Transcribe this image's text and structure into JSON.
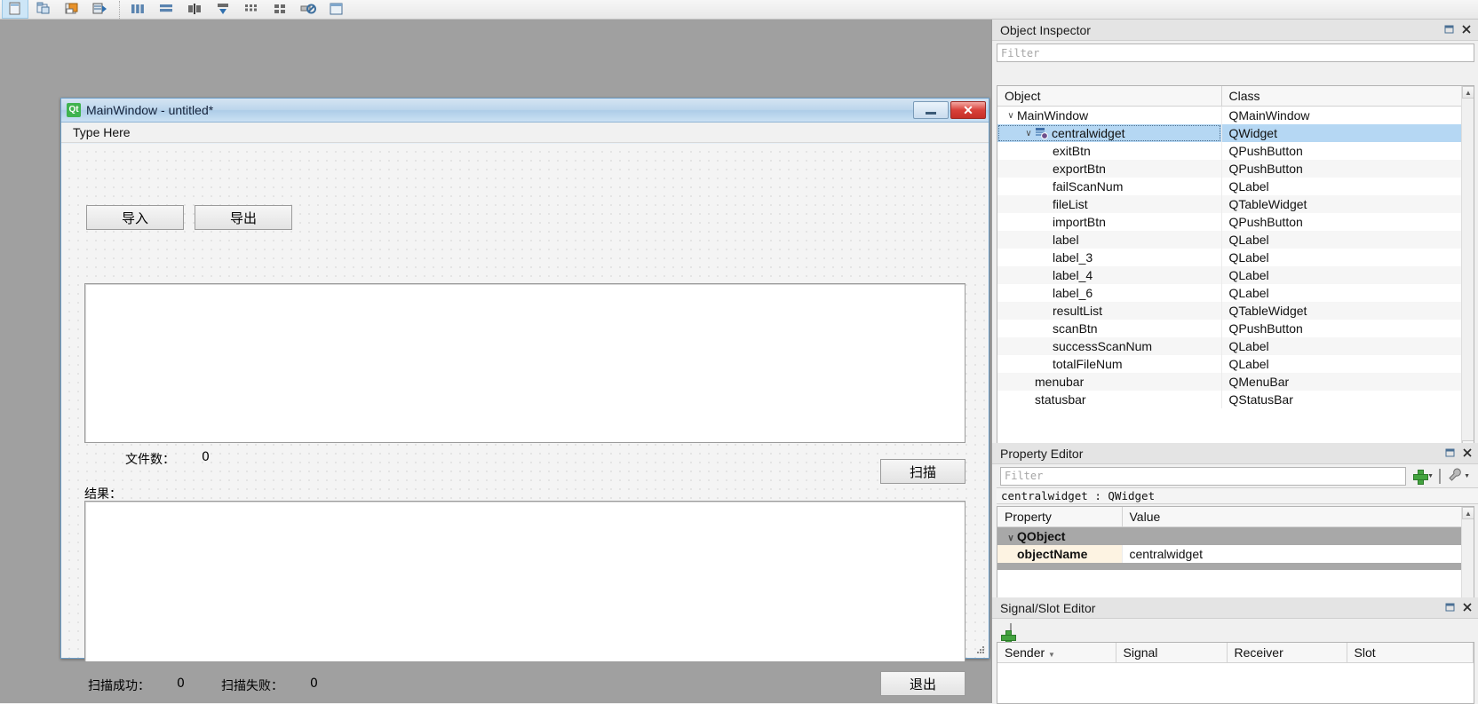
{
  "toolbar": {
    "icons": [
      {
        "name": "new-form-icon",
        "glyph": "▣",
        "selected": true
      },
      {
        "name": "open-form-icon",
        "glyph": "▤",
        "selected": false
      },
      {
        "name": "save-form-icon",
        "glyph": "◆",
        "selected": false
      },
      {
        "name": "print-preview-icon",
        "glyph": "▥",
        "selected": false
      },
      {
        "name": "separator",
        "glyph": "",
        "selected": false
      },
      {
        "name": "layout-horizontally-icon",
        "glyph": "‖",
        "selected": false
      },
      {
        "name": "layout-vertically-icon",
        "glyph": "≡",
        "selected": false
      },
      {
        "name": "layout-splitter-horizontal-icon",
        "glyph": "▦",
        "selected": false
      },
      {
        "name": "layout-splitter-vertical-icon",
        "glyph": "⊥",
        "selected": false
      },
      {
        "name": "layout-grid-icon",
        "glyph": "⌸",
        "selected": false
      },
      {
        "name": "layout-form-icon",
        "glyph": "⊞",
        "selected": false
      },
      {
        "name": "break-layout-icon",
        "glyph": "⛔",
        "selected": false
      },
      {
        "name": "adjust-size-icon",
        "glyph": "□",
        "selected": false
      }
    ]
  },
  "form": {
    "title": "MainWindow - untitled*",
    "logo_text": "Qt",
    "minimize_label": "",
    "close_label": "✕",
    "menubar_placeholder": "Type Here",
    "widgets": {
      "import_button": "导入",
      "export_button": "导出",
      "file_count_label": "文件数：",
      "file_count_value": "0",
      "scan_button": "扫描",
      "result_label": "结果：",
      "scan_success_label": "扫描成功：",
      "scan_success_value": "0",
      "scan_fail_label": "扫描失败：",
      "scan_fail_value": "0",
      "exit_button": "退出"
    }
  },
  "object_inspector": {
    "title": "Object Inspector",
    "filter_placeholder": "Filter",
    "columns": [
      "Object",
      "Class"
    ],
    "rows": [
      {
        "indent": 0,
        "chevron": "∨",
        "icon": "",
        "object": "MainWindow",
        "class": "QMainWindow",
        "selected": false
      },
      {
        "indent": 1,
        "chevron": "∨",
        "icon": "widget-icon",
        "object": "centralwidget",
        "class": "QWidget",
        "selected": true
      },
      {
        "indent": 2,
        "chevron": "",
        "icon": "",
        "object": "exitBtn",
        "class": "QPushButton",
        "selected": false
      },
      {
        "indent": 2,
        "chevron": "",
        "icon": "",
        "object": "exportBtn",
        "class": "QPushButton",
        "selected": false
      },
      {
        "indent": 2,
        "chevron": "",
        "icon": "",
        "object": "failScanNum",
        "class": "QLabel",
        "selected": false
      },
      {
        "indent": 2,
        "chevron": "",
        "icon": "",
        "object": "fileList",
        "class": "QTableWidget",
        "selected": false
      },
      {
        "indent": 2,
        "chevron": "",
        "icon": "",
        "object": "importBtn",
        "class": "QPushButton",
        "selected": false
      },
      {
        "indent": 2,
        "chevron": "",
        "icon": "",
        "object": "label",
        "class": "QLabel",
        "selected": false
      },
      {
        "indent": 2,
        "chevron": "",
        "icon": "",
        "object": "label_3",
        "class": "QLabel",
        "selected": false
      },
      {
        "indent": 2,
        "chevron": "",
        "icon": "",
        "object": "label_4",
        "class": "QLabel",
        "selected": false
      },
      {
        "indent": 2,
        "chevron": "",
        "icon": "",
        "object": "label_6",
        "class": "QLabel",
        "selected": false
      },
      {
        "indent": 2,
        "chevron": "",
        "icon": "",
        "object": "resultList",
        "class": "QTableWidget",
        "selected": false
      },
      {
        "indent": 2,
        "chevron": "",
        "icon": "",
        "object": "scanBtn",
        "class": "QPushButton",
        "selected": false
      },
      {
        "indent": 2,
        "chevron": "",
        "icon": "",
        "object": "successScanNum",
        "class": "QLabel",
        "selected": false
      },
      {
        "indent": 2,
        "chevron": "",
        "icon": "",
        "object": "totalFileNum",
        "class": "QLabel",
        "selected": false
      },
      {
        "indent": 1,
        "chevron": "",
        "icon": "",
        "object": "menubar",
        "class": "QMenuBar",
        "selected": false
      },
      {
        "indent": 1,
        "chevron": "",
        "icon": "",
        "object": "statusbar",
        "class": "QStatusBar",
        "selected": false
      }
    ]
  },
  "property_editor": {
    "title": "Property Editor",
    "filter_placeholder": "Filter",
    "class_line": "centralwidget : QWidget",
    "columns": [
      "Property",
      "Value"
    ],
    "group": "QObject",
    "group_chevron": "∨",
    "rows": [
      {
        "property": "objectName",
        "value": "centralwidget"
      }
    ]
  },
  "signal_slot_editor": {
    "title": "Signal/Slot Editor",
    "columns": [
      "Sender",
      "Signal",
      "Receiver",
      "Slot"
    ]
  },
  "dock_buttons": {
    "float": "❐",
    "close": "✕"
  },
  "colors": {
    "selection_blue": "#b5d7f3",
    "canvas_gray": "#a0a0a0",
    "qt_green": "#3fb34f",
    "close_red": "#d8413a",
    "group_header_gray": "#a8a8a8",
    "prop_name_cream": "#fdf3e2"
  }
}
